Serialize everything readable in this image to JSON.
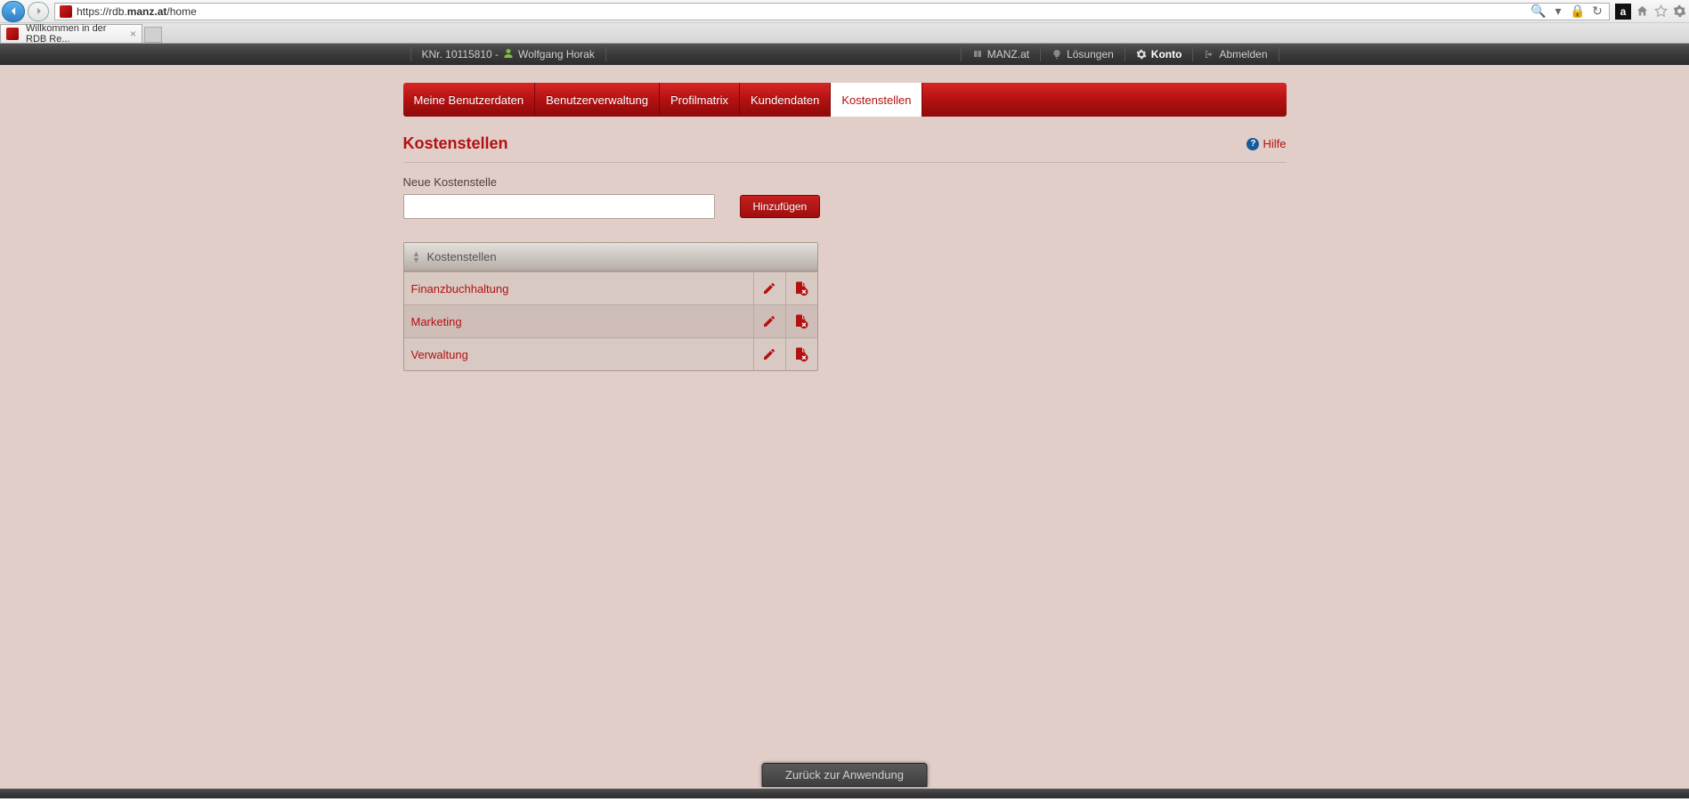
{
  "browser": {
    "url_prefix": "https://rdb.",
    "url_bold": "manz.at",
    "url_suffix": "/home",
    "tab_title": "Willkommen in der RDB Re...",
    "amazon_letter": "a"
  },
  "header": {
    "knr_label": "KNr. 10115810 -",
    "user_name": "Wolfgang Horak",
    "links": {
      "manz": "MANZ.at",
      "loesungen": "Lösungen",
      "konto": "Konto",
      "abmelden": "Abmelden"
    }
  },
  "tabs": [
    {
      "label": "Meine Benutzerdaten",
      "active": false
    },
    {
      "label": "Benutzerverwaltung",
      "active": false
    },
    {
      "label": "Profilmatrix",
      "active": false
    },
    {
      "label": "Kundendaten",
      "active": false
    },
    {
      "label": "Kostenstellen",
      "active": true
    }
  ],
  "page": {
    "title": "Kostenstellen",
    "help": "Hilfe",
    "form_label": "Neue Kostenstelle",
    "add_button": "Hinzufügen",
    "table_header": "Kostenstellen",
    "rows": [
      {
        "name": "Finanzbuchhaltung"
      },
      {
        "name": "Marketing"
      },
      {
        "name": "Verwaltung"
      }
    ]
  },
  "footer": {
    "back": "Zurück zur Anwendung"
  },
  "colors": {
    "accent": "#b31111"
  }
}
